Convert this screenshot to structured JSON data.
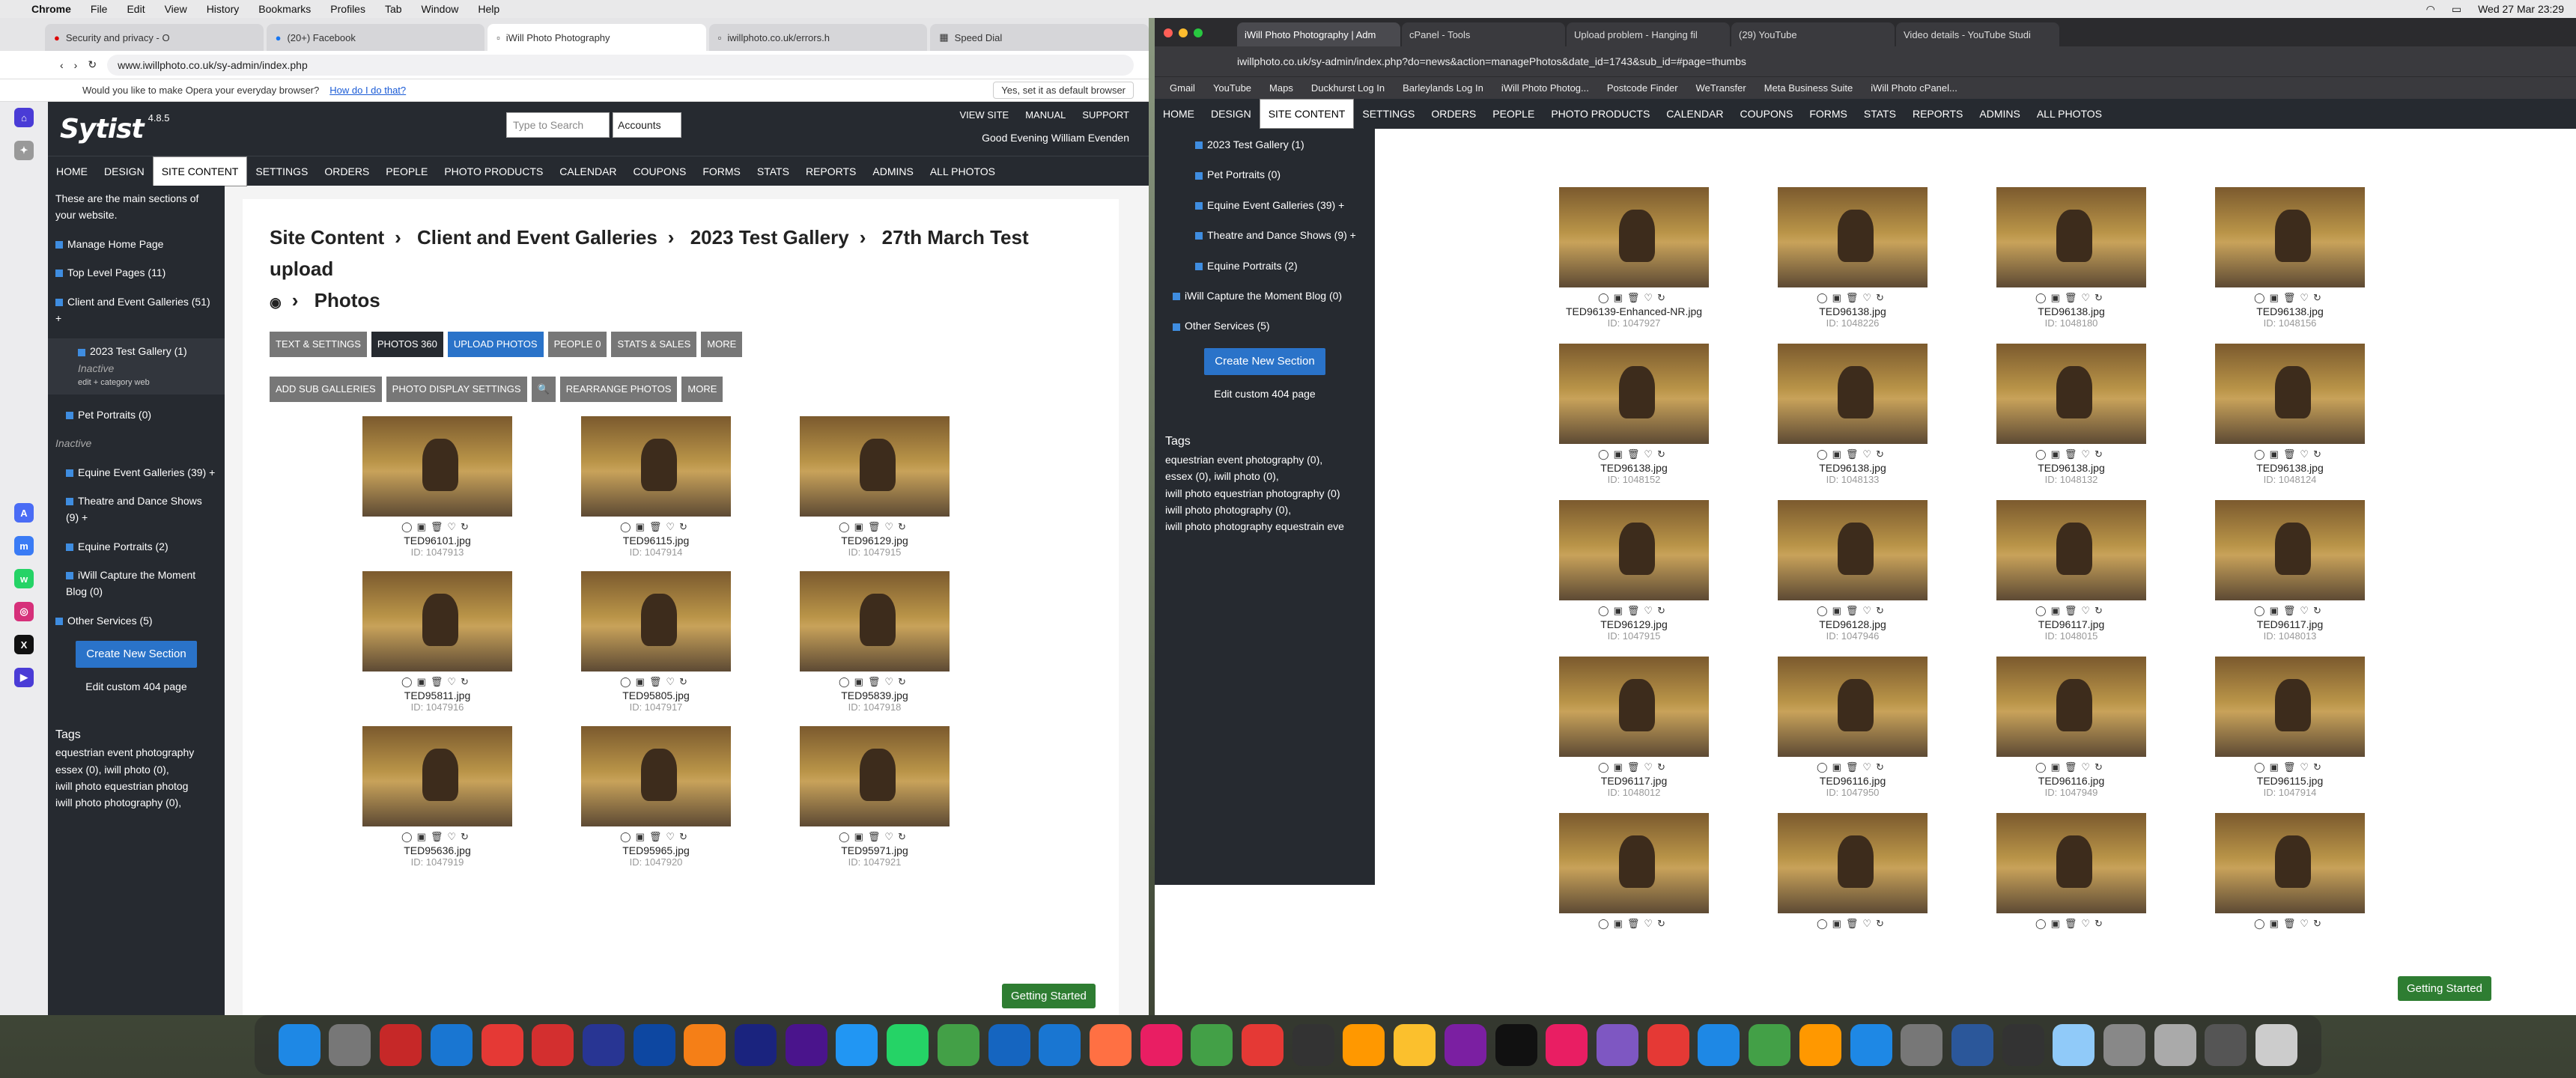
{
  "menubar": {
    "app": "Chrome",
    "items": [
      "File",
      "Edit",
      "View",
      "History",
      "Bookmarks",
      "Profiles",
      "Tab",
      "Window",
      "Help"
    ],
    "clock": "Wed 27 Mar 23:29"
  },
  "left_browser": {
    "tabs": [
      "Security and privacy - O",
      "(20+) Facebook",
      "iWill Photo Photography",
      "iwillphoto.co.uk/errors.h",
      "Speed Dial"
    ],
    "url": "www.iwillphoto.co.uk/sy-admin/index.php",
    "prompt": "Would you like to make Opera your everyday browser?",
    "prompt_link": "How do I do that?",
    "prompt_default": "Yes, set it as default browser",
    "app": {
      "logo": "Sytist",
      "version": "4.8.5",
      "search_placeholder": "Type to Search",
      "accounts": "Accounts",
      "view_site": "VIEW SITE",
      "manual": "MANUAL",
      "support": "SUPPORT",
      "greeting": "Good Evening William Evenden"
    },
    "nav": [
      "HOME",
      "DESIGN",
      "SITE CONTENT",
      "SETTINGS",
      "ORDERS",
      "PEOPLE",
      "PHOTO PRODUCTS",
      "CALENDAR",
      "COUPONS",
      "FORMS",
      "STATS",
      "REPORTS",
      "ADMINS",
      "ALL PHOTOS"
    ],
    "sidebar": {
      "intro": "These are the main sections of your website.",
      "items": [
        "Manage Home Page",
        "Top Level Pages (11)",
        "Client and Event Galleries (51) +",
        "2023 Test Gallery (1)",
        "Pet Portraits (0)",
        "Equine Event Galleries (39) +",
        "Theatre and Dance Shows (9) +",
        "Equine Portraits (2)",
        "iWill Capture the Moment Blog (0)",
        "Other Services (5)"
      ],
      "inactive": "Inactive",
      "sublinks": "edit   + category   web",
      "create": "Create New Section",
      "edit404": "Edit custom 404 page",
      "tags_title": "Tags",
      "tags": [
        "equestrian event photography",
        "essex (0), iwill photo (0),",
        "iwill photo equestrian photog",
        "iwill photo photography (0),"
      ]
    },
    "breadcrumb": [
      "Site Content",
      "Client and Event Galleries",
      "2023 Test Gallery",
      "27th March Test upload",
      "Photos"
    ],
    "toolbar1": [
      "TEXT & SETTINGS",
      "PHOTOS 360",
      "UPLOAD PHOTOS",
      "PEOPLE 0",
      "STATS & SALES",
      "MORE"
    ],
    "toolbar2": [
      "ADD SUB GALLERIES",
      "PHOTO DISPLAY SETTINGS",
      "🔍",
      "REARRANGE PHOTOS",
      "MORE"
    ],
    "photos": [
      {
        "name": "TED96101.jpg",
        "id": "ID: 1047913"
      },
      {
        "name": "TED96115.jpg",
        "id": "ID: 1047914"
      },
      {
        "name": "TED96129.jpg",
        "id": "ID: 1047915"
      },
      {
        "name": "TED95811.jpg",
        "id": "ID: 1047916"
      },
      {
        "name": "TED95805.jpg",
        "id": "ID: 1047917"
      },
      {
        "name": "TED95839.jpg",
        "id": "ID: 1047918"
      },
      {
        "name": "TED95636.jpg",
        "id": "ID: 1047919"
      },
      {
        "name": "TED95965.jpg",
        "id": "ID: 1047920"
      },
      {
        "name": "TED95971.jpg",
        "id": "ID: 1047921"
      }
    ],
    "getting_started": "Getting Started"
  },
  "right_browser": {
    "tabs": [
      "iWill Photo Photography | Adm",
      "cPanel - Tools",
      "Upload problem - Hanging fil",
      "(29) YouTube",
      "Video details - YouTube Studi"
    ],
    "url": "iwillphoto.co.uk/sy-admin/index.php?do=news&action=managePhotos&date_id=1743&sub_id=#page=thumbs",
    "bookmarks": [
      "Gmail",
      "YouTube",
      "Maps",
      "Duckhurst Log In",
      "Barleylands Log In",
      "iWill Photo Photog...",
      "Postcode Finder",
      "WeTransfer",
      "Meta Business Suite",
      "iWill Photo cPanel..."
    ],
    "nav": [
      "HOME",
      "DESIGN",
      "SITE CONTENT",
      "SETTINGS",
      "ORDERS",
      "PEOPLE",
      "PHOTO PRODUCTS",
      "CALENDAR",
      "COUPONS",
      "FORMS",
      "STATS",
      "REPORTS",
      "ADMINS",
      "ALL PHOTOS"
    ],
    "sidebar": [
      "2023 Test Gallery (1)",
      "Pet Portraits (0)",
      "Equine Event Galleries (39) +",
      "Theatre and Dance Shows (9) +",
      "Equine Portraits (2)",
      "iWill Capture the Moment Blog (0)",
      "Other Services (5)"
    ],
    "create": "Create New Section",
    "edit404": "Edit custom 404 page",
    "tags_title": "Tags",
    "tags": [
      "equestrian event photography (0),",
      "essex (0), iwill photo (0),",
      "iwill photo equestrian photography (0)",
      "iwill photo photography (0),",
      "iwill photo photography equestrain eve"
    ],
    "photos": [
      {
        "name": "TED96139-Enhanced-NR.jpg",
        "id": "ID: 1047927"
      },
      {
        "name": "TED96138.jpg",
        "id": "ID: 1048226"
      },
      {
        "name": "TED96138.jpg",
        "id": "ID: 1048180"
      },
      {
        "name": "TED96138.jpg",
        "id": "ID: 1048156"
      },
      {
        "name": "TED96138.jpg",
        "id": "ID: 1048152"
      },
      {
        "name": "TED96138.jpg",
        "id": "ID: 1048133"
      },
      {
        "name": "TED96138.jpg",
        "id": "ID: 1048132"
      },
      {
        "name": "TED96138.jpg",
        "id": "ID: 1048124"
      },
      {
        "name": "TED96129.jpg",
        "id": "ID: 1047915"
      },
      {
        "name": "TED96128.jpg",
        "id": "ID: 1047946"
      },
      {
        "name": "TED96117.jpg",
        "id": "ID: 1048015"
      },
      {
        "name": "TED96117.jpg",
        "id": "ID: 1048013"
      },
      {
        "name": "TED96117.jpg",
        "id": "ID: 1048012"
      },
      {
        "name": "TED96116.jpg",
        "id": "ID: 1047950"
      },
      {
        "name": "TED96116.jpg",
        "id": "ID: 1047949"
      },
      {
        "name": "TED96115.jpg",
        "id": "ID: 1047914"
      },
      {
        "name": "",
        "id": ""
      },
      {
        "name": "",
        "id": ""
      },
      {
        "name": "",
        "id": ""
      },
      {
        "name": "",
        "id": ""
      }
    ],
    "getting_started": "Getting Started"
  }
}
